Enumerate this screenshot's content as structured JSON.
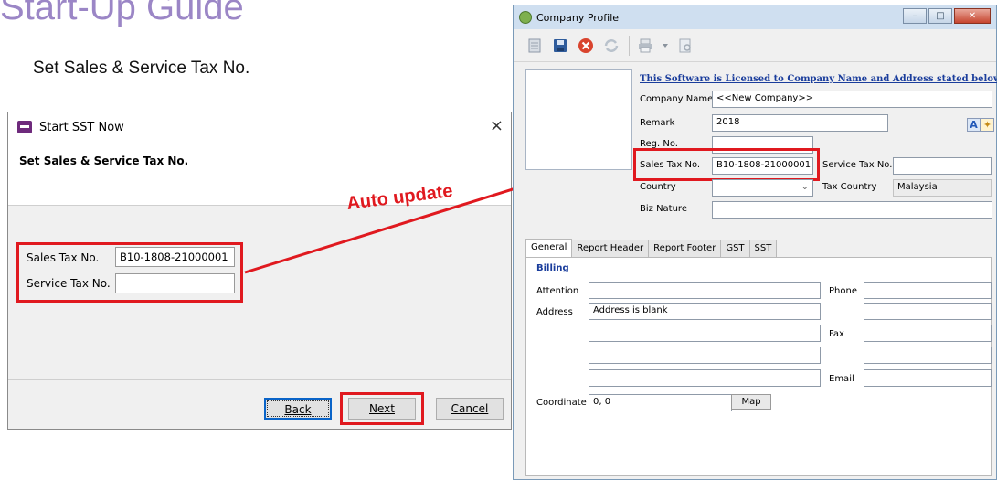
{
  "slide": {
    "title": "Start-Up Guide",
    "subtitle": "Set Sales & Service Tax No.",
    "annotation": "Auto update"
  },
  "colors": {
    "highlight": "#e0191f",
    "title": "#9b86c6",
    "link": "#1a3d9c"
  },
  "sst_dialog": {
    "title": "Start SST Now",
    "heading": "Set Sales & Service Tax No.",
    "fields": [
      {
        "label": "Sales Tax No.",
        "value": "B10-1808-21000001"
      },
      {
        "label": "Service Tax No.",
        "value": ""
      }
    ],
    "buttons": {
      "back": "Back",
      "next": "Next",
      "cancel": "Cancel"
    },
    "close_glyph": "×"
  },
  "company_profile": {
    "title": "Company Profile",
    "licensed_text": "This Software is Licensed to Company Name and Address stated below :-",
    "company_name_label": "Company Name",
    "company_name_value": "<<New Company>>",
    "remark_label": "Remark",
    "remark_value": "2018",
    "reg_no_label": "Reg. No.",
    "reg_no_value": "",
    "sales_tax_label": "Sales Tax No.",
    "sales_tax_value": "B10-1808-21000001",
    "service_tax_label": "Service Tax No.",
    "service_tax_value": "",
    "country_label": "Country",
    "country_value": "",
    "tax_country_label": "Tax Country",
    "tax_country_value": "Malaysia",
    "biz_nature_label": "Biz Nature",
    "biz_nature_value": "",
    "font_buttons": [
      "A",
      "✦"
    ],
    "tabs": [
      "General",
      "Report Header",
      "Report Footer",
      "GST",
      "SST"
    ],
    "billing_label": "Billing",
    "attention_label": "Attention",
    "address_label": "Address",
    "address_values": [
      "Address is blank",
      "",
      "",
      ""
    ],
    "phone_label": "Phone",
    "fax_label": "Fax",
    "email_label": "Email",
    "coordinate_label": "Coordinate",
    "coordinate_value": "0, 0",
    "map_button": "Map"
  },
  "icons": [
    "document-icon",
    "save-icon",
    "delete-icon",
    "refresh-icon",
    "print-icon",
    "preview-icon"
  ]
}
